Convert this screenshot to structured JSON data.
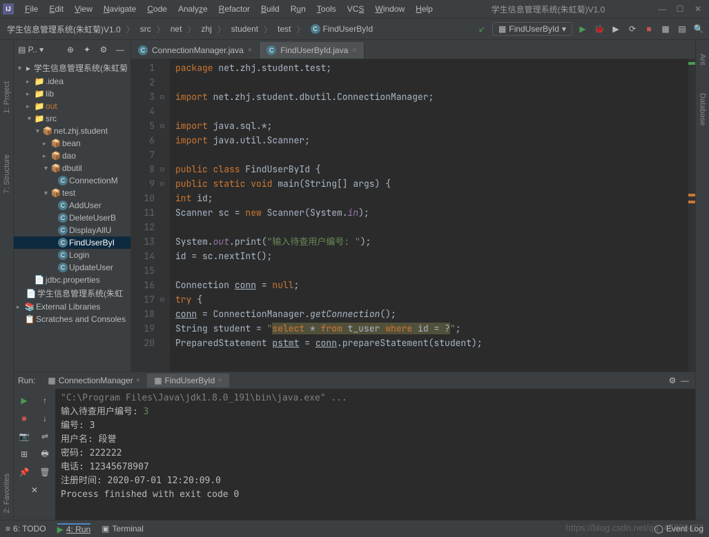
{
  "window": {
    "title": "学生信息管理系统(朱虹菊)V1.0"
  },
  "menus": [
    "File",
    "Edit",
    "View",
    "Navigate",
    "Code",
    "Analyze",
    "Refactor",
    "Build",
    "Run",
    "Tools",
    "VCS",
    "Window",
    "Help"
  ],
  "breadcrumbs": {
    "root": "学生信息管理系统(朱虹菊)V1.0",
    "items": [
      "src",
      "net",
      "zhj",
      "student",
      "test",
      "FindUserById"
    ]
  },
  "runConfig": "FindUserById",
  "project": {
    "toolbar_label": "P..",
    "root": "学生信息管理系统(朱虹菊",
    "idea": ".idea",
    "lib": "lib",
    "out": "out",
    "src": "src",
    "pkg": "net.zhj.student",
    "bean": "bean",
    "dao": "dao",
    "dbutil": "dbutil",
    "connmgr": "ConnectionM",
    "test": "test",
    "adduser": "AddUser",
    "deleteuser": "DeleteUserB",
    "displayall": "DisplayAllU",
    "finduser": "FindUserByI",
    "login": "Login",
    "updateuser": "UpdateUser",
    "jdbcprops": "jdbc.properties",
    "imlfile": "学生信息管理系统(朱虹",
    "extlibs": "External Libraries",
    "scratch": "Scratches and Consoles"
  },
  "tabs": [
    {
      "label": "ConnectionManager.java",
      "active": false
    },
    {
      "label": "FindUserById.java",
      "active": true
    }
  ],
  "code": {
    "lines": [
      {
        "n": 1,
        "html": "<span class='kw'>package</span> net.zhj.student.test;"
      },
      {
        "n": 2,
        "html": ""
      },
      {
        "n": 3,
        "html": "<span class='kw'>import</span> net.zhj.student.dbutil.ConnectionManager;"
      },
      {
        "n": 4,
        "html": ""
      },
      {
        "n": 5,
        "html": "<span class='kw'>import</span> java.sql.*;"
      },
      {
        "n": 6,
        "html": "<span class='kw'>import</span> java.util.Scanner;"
      },
      {
        "n": 7,
        "html": ""
      },
      {
        "n": 8,
        "html": "<span class='kw'>public class</span> FindUserById {"
      },
      {
        "n": 9,
        "html": "    <span class='kw'>public static void</span> main(String[] args) {"
      },
      {
        "n": 10,
        "html": "        <span class='kw'>int</span> id;"
      },
      {
        "n": 11,
        "html": "        Scanner sc = <span class='kw'>new</span> Scanner(System.<span class='id-static'>in</span>);"
      },
      {
        "n": 12,
        "html": ""
      },
      {
        "n": 13,
        "html": "        System.<span class='id-static'>out</span>.print(<span class='str'>\"输入待查用户编号: \"</span>);"
      },
      {
        "n": 14,
        "html": "        id = sc.nextInt();"
      },
      {
        "n": 15,
        "html": ""
      },
      {
        "n": 16,
        "html": "        Connection <span class='underline'>conn</span> = <span class='kw'>null</span>;"
      },
      {
        "n": 17,
        "html": "        <span class='kw'>try</span> {"
      },
      {
        "n": 18,
        "html": "            <span class='underline'>conn</span> = ConnectionManager.<span style='font-style:italic'>getConnection</span>();"
      },
      {
        "n": 19,
        "html": "            String student = <span class='str'>\"</span><span class='highlight-yellow'><span class='kw'>select</span> * <span class='kw'>from</span> t_user <span class='kw'>where</span> id = ?</span><span class='str'>\"</span>;"
      },
      {
        "n": 20,
        "html": "            PreparedStatement <span class='underline'>pstmt</span> = <span class='underline'>conn</span>.prepareStatement(student);"
      }
    ]
  },
  "run": {
    "label": "Run:",
    "tabs": [
      {
        "label": "ConnectionManager",
        "active": false
      },
      {
        "label": "FindUserById",
        "active": true
      }
    ],
    "output_lines": [
      {
        "text": "\"C:\\Program Files\\Java\\jdk1.8.0_191\\bin\\java.exe\" ...",
        "cls": "gray"
      },
      {
        "text": "输入待查用户编号: ",
        "cls": "",
        "suffix": "3",
        "suffix_cls": "input-green"
      },
      {
        "text": "编号: 3",
        "cls": ""
      },
      {
        "text": "用户名: 段誉",
        "cls": ""
      },
      {
        "text": "密码: 222222",
        "cls": ""
      },
      {
        "text": "电话: 12345678907",
        "cls": ""
      },
      {
        "text": "注册时间: 2020-07-01 12:20:09.0",
        "cls": ""
      },
      {
        "text": "",
        "cls": ""
      },
      {
        "text": "Process finished with exit code 0",
        "cls": ""
      }
    ]
  },
  "statusBar": {
    "todo": "6: TODO",
    "run": "4: Run",
    "terminal": "Terminal",
    "eventlog": "Event Log"
  },
  "gutters": {
    "project": "1: Project",
    "structure": "7: Structure",
    "favorites": "2: Favorites",
    "ant": "Ant",
    "database": "Database"
  },
  "watermark": "https://blog.csdn.net/qq_45893453"
}
